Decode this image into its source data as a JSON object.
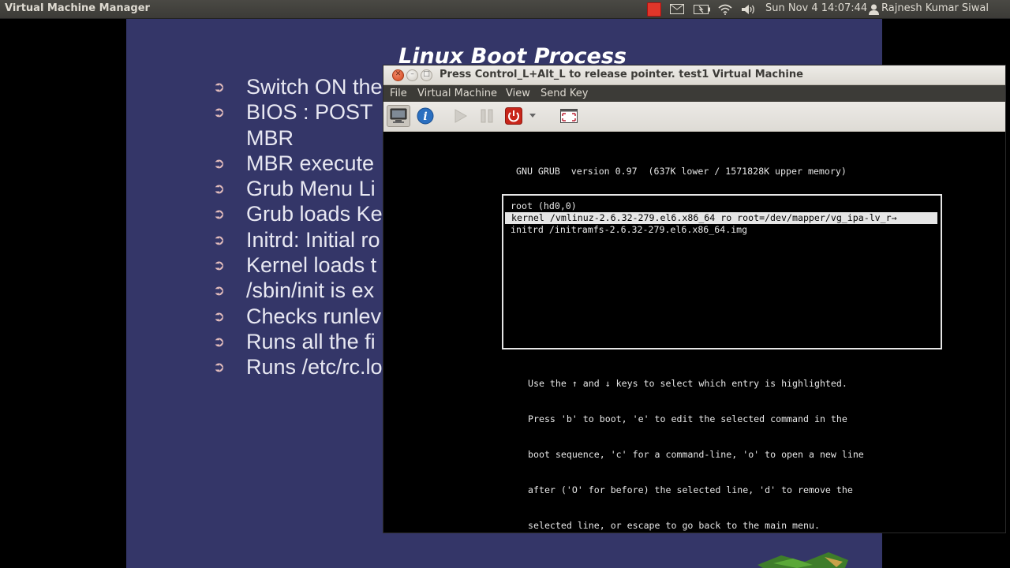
{
  "top_panel": {
    "app_title": "Virtual Machine Manager",
    "datetime": "Sun Nov  4 14:07:44",
    "user": "Rajnesh Kumar Siwal",
    "indicators": [
      "record-indicator-icon",
      "mail-icon",
      "battery-icon",
      "wifi-icon",
      "volume-icon",
      "user-icon"
    ]
  },
  "slide": {
    "title": "Linux Boot Process",
    "bullets": [
      "Switch ON the",
      "BIOS : POST",
      "MBR",
      "MBR  execute",
      "Grub Menu Li",
      "Grub loads Ke",
      "Initrd: Initial ro",
      "Kernel loads t",
      "/sbin/init is ex",
      "Checks runlev",
      "Runs all the fi",
      "Runs /etc/rc.lo"
    ],
    "bullet_glyph": "➲"
  },
  "vm_window": {
    "title": "Press Control_L+Alt_L to release pointer. test1 Virtual Machine",
    "menu": [
      "File",
      "Virtual Machine",
      "View",
      "Send Key"
    ],
    "toolbar": [
      {
        "name": "console-icon",
        "active": true
      },
      {
        "name": "details-icon",
        "active": false
      },
      {
        "name": "run-icon",
        "active": false
      },
      {
        "name": "pause-icon",
        "active": false
      },
      {
        "name": "shutdown-icon",
        "active": false
      },
      {
        "name": "shutdown-menu-arrow-icon",
        "active": false
      },
      {
        "name": "fullscreen-icon",
        "active": false
      }
    ]
  },
  "console": {
    "header": "GNU GRUB  version 0.97  (637K lower / 1571828K upper memory)",
    "entries": [
      {
        "text": "root (hd0,0)",
        "selected": false
      },
      {
        "text": "kernel /vmlinuz-2.6.32-279.el6.x86_64 ro root=/dev/mapper/vg_ipa-lv_r→",
        "selected": true
      },
      {
        "text": "initrd /initramfs-2.6.32-279.el6.x86_64.img",
        "selected": false
      }
    ],
    "help": [
      "Use the ↑ and ↓ keys to select which entry is highlighted.",
      "Press 'b' to boot, 'e' to edit the selected command in the",
      "boot sequence, 'c' for a command-line, 'o' to open a new line",
      "after ('O' for before) the selected line, 'd' to remove the",
      "selected line, or escape to go back to the main menu."
    ]
  },
  "colors": {
    "slide_bg": "#343668",
    "panel_bg": "#3c3b37",
    "close_button": "#d4471d",
    "shutdown_red": "#c8261b",
    "info_blue": "#2a6fc0"
  }
}
